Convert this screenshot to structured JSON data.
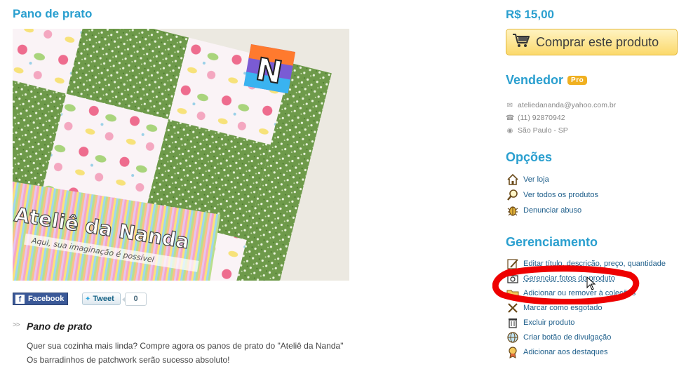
{
  "product": {
    "title": "Pano de prato",
    "photo_text": {
      "logo_line1": "Ateliê da Nanda",
      "logo_line2": "Aqui, sua imaginação é possível"
    }
  },
  "share": {
    "facebook_label": "Facebook",
    "tweet_label": "Tweet",
    "tweet_count": "0"
  },
  "description": {
    "title": "Pano de prato",
    "lines": [
      "Quer sua cozinha mais linda? Compre agora os panos de prato do \"Ateliê da Nanda\"",
      "Os barradinhos de patchwork serão sucesso absoluto!"
    ]
  },
  "sidebar": {
    "price": "R$ 15,00",
    "buy_label": "Comprar este produto",
    "seller": {
      "heading": "Vendedor",
      "badge": "Pro",
      "email": "ateliedananda@yahoo.com.br",
      "phone": "(11) 92870942",
      "location": "São Paulo - SP"
    },
    "options": {
      "heading": "Opções",
      "items": [
        "Ver loja",
        "Ver todos os produtos",
        "Denunciar abuso"
      ]
    },
    "management": {
      "heading": "Gerenciamento",
      "items": [
        "Editar título, descrição, preço, quantidade",
        "Gerenciar fotos do produto",
        "Adicionar ou remover à coleções",
        "Marcar como esgotado",
        "Excluir produto",
        "Criar botão de divulgação",
        "Adicionar aos destaques"
      ]
    }
  },
  "colors": {
    "accent": "#2a9fcf",
    "link": "#1f5f8b",
    "highlight_circle": "#ee0000",
    "pro_badge": "#f0b020"
  }
}
